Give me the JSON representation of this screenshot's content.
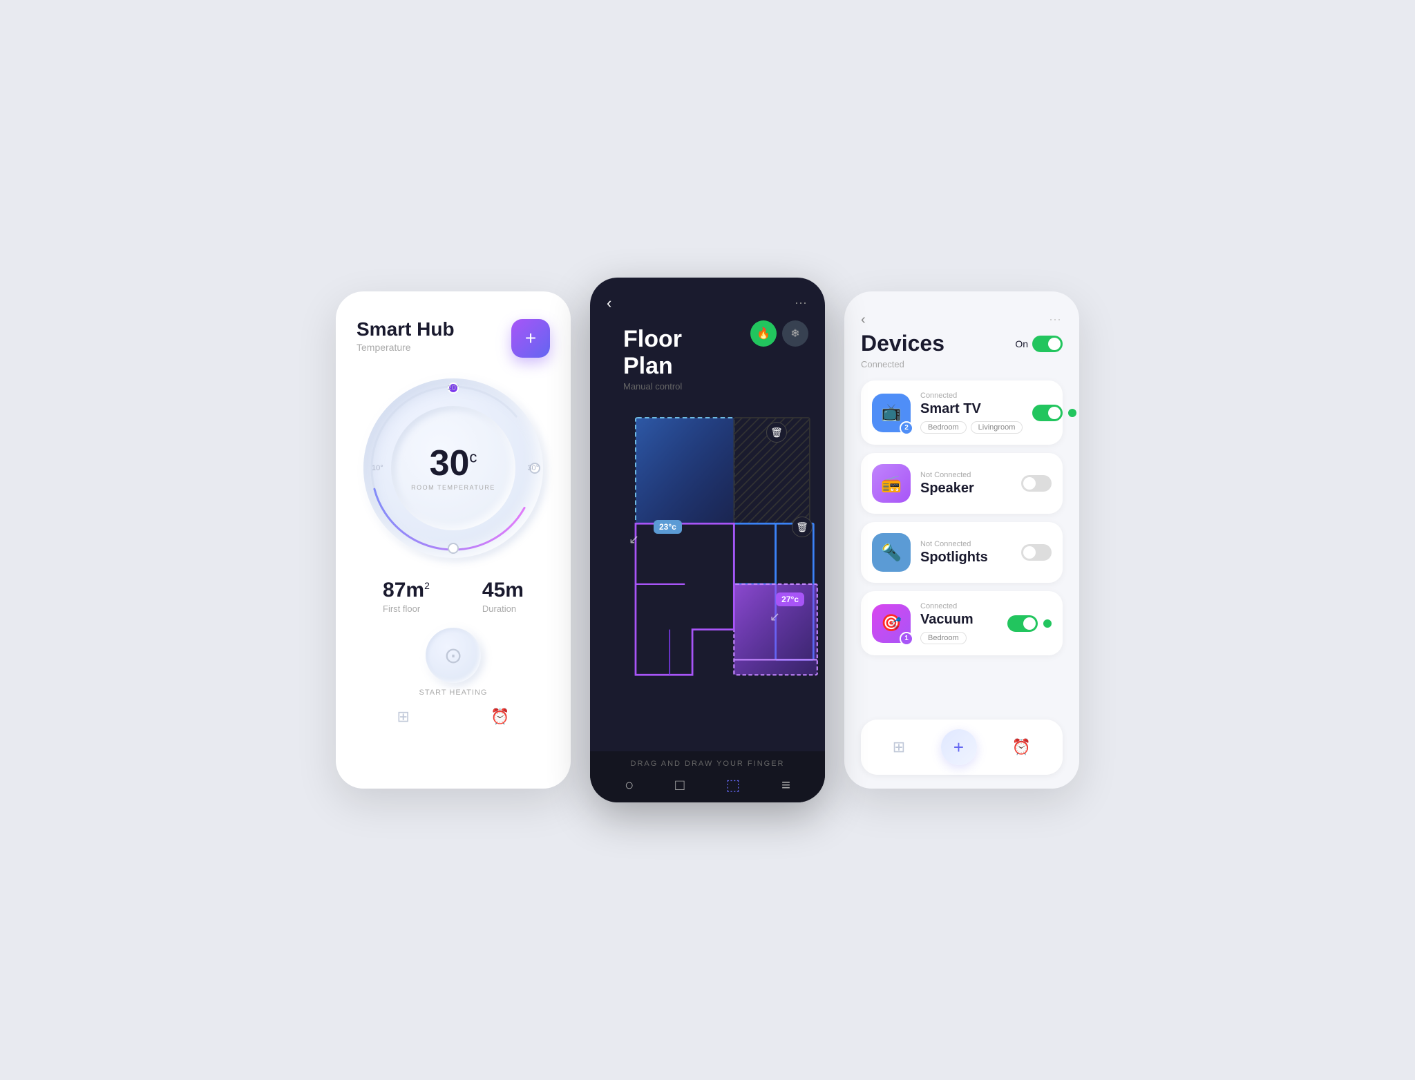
{
  "screen1": {
    "title": "Smart Hub",
    "subtitle": "Temperature",
    "add_label": "+",
    "temperature": "30",
    "temp_unit": "c",
    "temp_label": "ROOM TEMPERATURE",
    "tick_10": "10°",
    "tick_20": "20°",
    "tick_30": "30°",
    "area_value": "87m",
    "area_unit": "2",
    "area_label": "First floor",
    "duration_value": "45m",
    "duration_label": "Duration",
    "start_label": "START HEATING"
  },
  "screen2": {
    "title": "Floor Plan",
    "subtitle": "Manual control",
    "toolbar_label": "DRAG AND DRAW YOUR FINGER",
    "temp1": "23°c",
    "temp2": "27°c"
  },
  "screen3": {
    "title": "Devices",
    "on_label": "On",
    "connected_label": "Connected",
    "devices": [
      {
        "name": "Smart TV",
        "status": "Connected",
        "connected": true,
        "tags": [
          "Bedroom",
          "Livingroom"
        ],
        "badge": "2",
        "icon": "tv"
      },
      {
        "name": "Speaker",
        "status": "Not Connected",
        "connected": false,
        "tags": [],
        "badge": null,
        "icon": "speaker"
      },
      {
        "name": "Spotlights",
        "status": "Not Connected",
        "connected": false,
        "tags": [],
        "badge": null,
        "icon": "spotlight"
      },
      {
        "name": "Vacuum",
        "status": "Connected",
        "connected": true,
        "tags": [
          "Bedroom"
        ],
        "badge": "1",
        "icon": "vacuum"
      }
    ],
    "nav": {
      "add_label": "+"
    }
  }
}
